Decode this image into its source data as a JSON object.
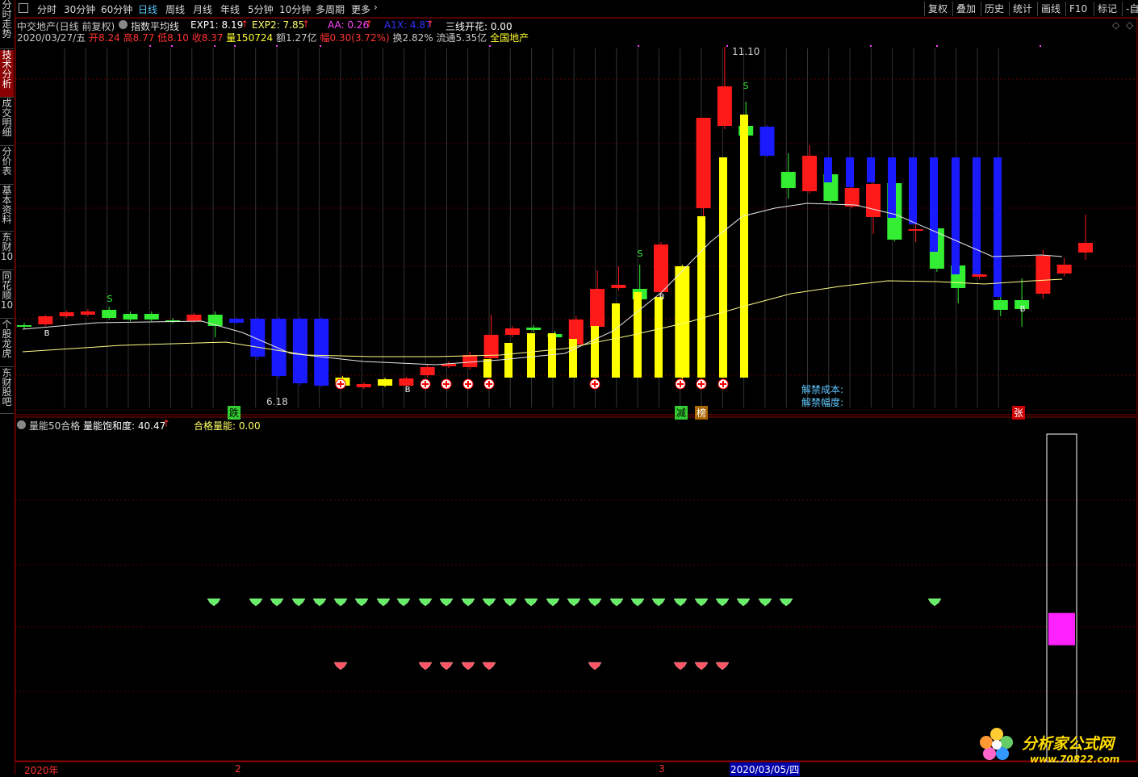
{
  "toolbar": {
    "menu_icon": "square-menu-icon",
    "periods": [
      {
        "label": "分时",
        "active": false
      },
      {
        "label": "30分钟",
        "active": false
      },
      {
        "label": "60分钟",
        "active": false
      },
      {
        "label": "日线",
        "active": true
      },
      {
        "label": "周线",
        "active": false
      },
      {
        "label": "月线",
        "active": false
      },
      {
        "label": "年线",
        "active": false
      },
      {
        "label": "5分钟",
        "active": false
      },
      {
        "label": "10分钟",
        "active": false
      },
      {
        "label": "多周期",
        "active": false
      },
      {
        "label": "更多",
        "active": false
      }
    ],
    "right_buttons": [
      "复权",
      "叠加",
      "历史",
      "统计",
      "画线",
      "F10",
      "标记",
      "-自"
    ]
  },
  "sidebar": {
    "tabs": [
      {
        "label": "分时走势",
        "active": false
      },
      {
        "label": "技术分析",
        "active": true
      },
      {
        "label": "成交明细",
        "active": false
      },
      {
        "label": "分价表",
        "active": false
      },
      {
        "label": "基本资料",
        "active": false
      },
      {
        "label": "东财10",
        "active": false
      },
      {
        "label": "同花顺10",
        "active": false
      },
      {
        "label": "个股龙虎",
        "active": false
      },
      {
        "label": "东财股吧",
        "active": false
      }
    ]
  },
  "main_panel": {
    "stock_title": "中交地产(日线 前复权)",
    "indicator_name": "指数平均线",
    "exp1_label": "EXP1: 8.19",
    "exp2_label": "EXP2: 7.85",
    "aa_label": "AA: 0.26",
    "a1x_label": "A1X: 4.87",
    "sanxian_label": "三线开花: 0.00",
    "bar_info": {
      "date": "2020/03/27/五",
      "open": "开8.24",
      "high": "高8.77",
      "low": "低8.10",
      "close": "收8.37",
      "volume": "量150724",
      "amount": "额1.27亿",
      "change": "幅0.30(3.72%)",
      "turnover": "换2.82%",
      "float": "流通5.35亿",
      "sector": "全国地产"
    },
    "jiejin_cost": "解禁成本:",
    "jiejin_range": "解禁幅度:",
    "high_price_label": "11.10",
    "low_price_label": "6.18",
    "marker_die": "跌",
    "marker_jian": "减",
    "marker_bang": "榜",
    "marker_zhang": "张"
  },
  "sub_panel": {
    "name": "量能50合格",
    "saturation_label": "量能饱和度: 40.47",
    "qualified_label": "合格量能: 0.00",
    "saturation_value": 40.47
  },
  "time_axis": {
    "labels": [
      "2020年",
      "2",
      "3"
    ],
    "current_date": "2020/03/05/四"
  },
  "watermark": {
    "text": "分析家公式网",
    "url": "www.70822.com"
  },
  "colors": {
    "up": "#ff1a1a",
    "down_green": "#33ee33",
    "blue": "#1a1aff",
    "yellow": "#ffff00",
    "frame": "#8b0000",
    "highlight_date": "#0000aa"
  }
}
